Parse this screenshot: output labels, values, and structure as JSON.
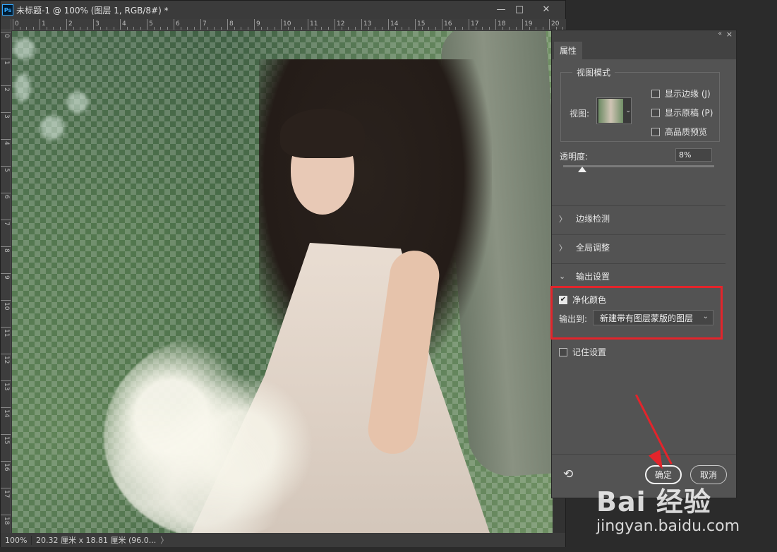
{
  "window": {
    "app_badge": "Ps",
    "title": "未标题-1 @ 100% (图层 1, RGB/8#) *",
    "minimize": "—",
    "maximize": "□",
    "close": "✕"
  },
  "ruler": {
    "top_labels": [
      "0",
      "1",
      "2",
      "3",
      "4",
      "5",
      "6",
      "7",
      "8",
      "9",
      "10",
      "11",
      "12",
      "13",
      "14",
      "15",
      "16",
      "17",
      "18",
      "19",
      "20"
    ],
    "left_labels": [
      "0",
      "1",
      "2",
      "3",
      "4",
      "5",
      "6",
      "7",
      "8",
      "9",
      "10",
      "11",
      "12",
      "13",
      "14",
      "15",
      "16",
      "17",
      "18"
    ]
  },
  "status": {
    "zoom": "100%",
    "info": "20.32 厘米 x 18.81 厘米 (96.0...",
    "arrow": "〉"
  },
  "panel": {
    "tab": "属性",
    "collapse_icon": "«",
    "close_icon": "×",
    "view_mode": {
      "legend": "视图模式",
      "view_label": "视图:",
      "options": [
        {
          "label": "显示边缘 (J)",
          "checked": false
        },
        {
          "label": "显示原稿 (P)",
          "checked": false
        },
        {
          "label": "高品质预览",
          "checked": false
        }
      ]
    },
    "opacity": {
      "label": "透明度:",
      "value": "8%",
      "level": 0.08
    },
    "sections": [
      {
        "label": "边缘检测",
        "expanded": false
      },
      {
        "label": "全局调整",
        "expanded": false
      },
      {
        "label": "输出设置",
        "expanded": true
      }
    ],
    "output": {
      "purify_label": "净化颜色",
      "purify_checked": true,
      "output_to_label": "输出到:",
      "output_to_value": "新建带有图层蒙版的图层"
    },
    "remember_label": "记住设置",
    "remember_checked": false,
    "ok_label": "确定",
    "cancel_label": "取消"
  },
  "watermark": {
    "logo": "Bai 经验",
    "url": "jingyan.baidu.com"
  },
  "colors": {
    "highlight": "#e3242b",
    "panel_bg": "#535353"
  }
}
